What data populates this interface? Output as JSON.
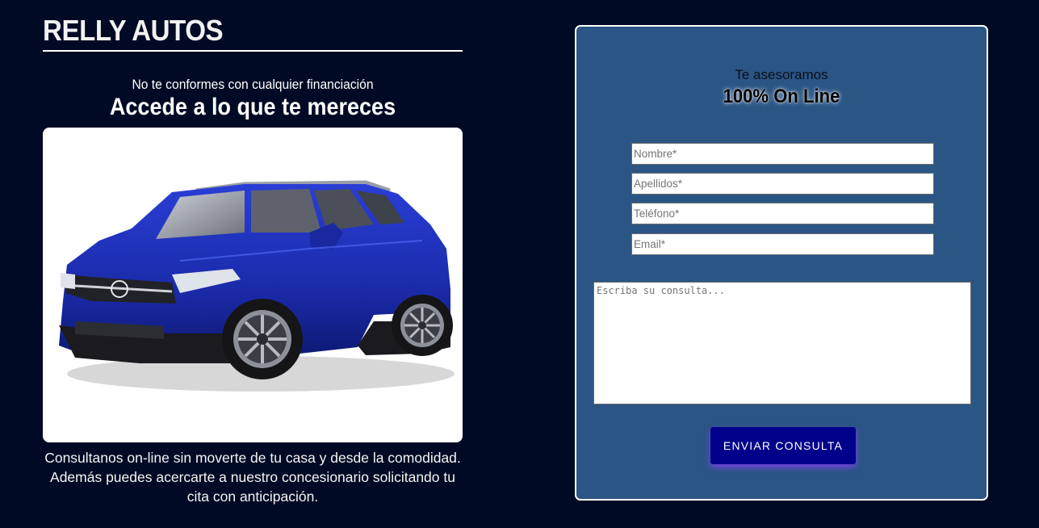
{
  "brand": {
    "name": "RELLY AUTOS"
  },
  "hero": {
    "tagline_small": "No te conformes con cualquier financiación",
    "tagline_big": "Accede a lo que te mereces",
    "image_alt": "blue-suv-photo",
    "blurb_lines": [
      "Consultanos on-line sin moverte de tu casa y desde la comodidad.",
      "Además puedes acercarte a nuestro concesionario solicitando tu",
      "cita con anticipación."
    ]
  },
  "form": {
    "subtitle": "Te asesoramos",
    "title": "100% On Line",
    "fields": {
      "nombre": {
        "placeholder": "Nombre*",
        "value": ""
      },
      "apellidos": {
        "placeholder": "Apellidos*",
        "value": ""
      },
      "telefono": {
        "placeholder": "Teléfono*",
        "value": ""
      },
      "email": {
        "placeholder": "Email*",
        "value": ""
      }
    },
    "message": {
      "placeholder": "Escriba su consulta...",
      "value": ""
    },
    "submit_label": "ENVIAR CONSULTA"
  },
  "colors": {
    "page_background": "#000a24",
    "panel_background": "#2b5585",
    "button_background": "#00008b",
    "button_glow": "#8c3cff",
    "car_body": "#1f2fb0"
  }
}
